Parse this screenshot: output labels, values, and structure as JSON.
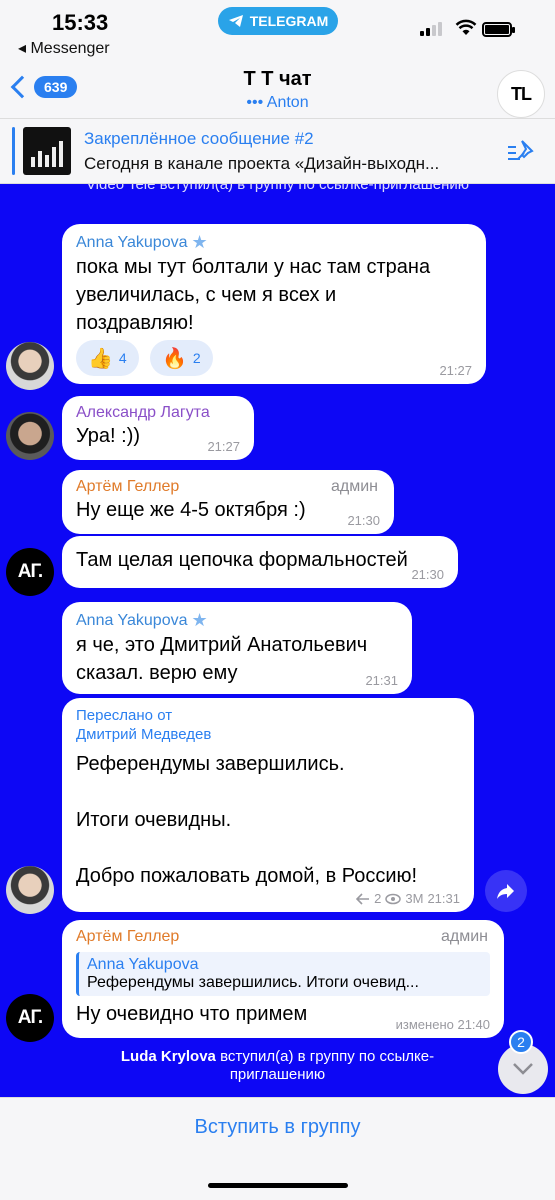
{
  "status": {
    "time": "15:33",
    "back_app": "◂ Messenger",
    "pill_label": "TELEGRAM"
  },
  "header": {
    "unread_count": "639",
    "title": "Т Т чат",
    "subtitle": "••• Anton",
    "avatar_text": "TL"
  },
  "pinned": {
    "title": "Закреплённое сообщение #2",
    "text": "Сегодня в канале проекта «Дизайн-выходн..."
  },
  "chat": {
    "top_service": "Video Tele вступил(а) в группу по ссылке-приглашению",
    "top_service_tail": "приглашению",
    "messages": [
      {
        "sender": "Anna Yakupova",
        "sender_color": "#3a87d8",
        "verified": "★",
        "lines": [
          "пока мы тут болтали у нас там страна",
          "увеличилась, с чем я всех и",
          "поздравляю!"
        ],
        "reactions": [
          {
            "emoji": "👍",
            "count": "4"
          },
          {
            "emoji": "🔥",
            "count": "2"
          }
        ],
        "time": "21:27"
      },
      {
        "sender": "Александр Лагута",
        "sender_color": "#8a4fc8",
        "text": "Ура! :))",
        "time": "21:27"
      },
      {
        "sender": "Артём Геллер",
        "sender_color": "#e07b2a",
        "role": "админ",
        "text": "Ну еще же 4-5 октября :)",
        "time": "21:30"
      },
      {
        "text": "Там целая цепочка формальностей",
        "time": "21:30"
      },
      {
        "sender": "Anna Yakupova",
        "sender_color": "#3a87d8",
        "verified": "★",
        "lines": [
          "я че, это Дмитрий Анатольевич",
          "сказал. верю ему"
        ],
        "time": "21:31"
      },
      {
        "forward_label": "Переслано от",
        "forward_from": "Дмитрий Медведев",
        "lines": [
          "Референдумы завершились.",
          "",
          "Итоги очевидны.",
          "",
          "Добро пожаловать домой, в Россию!"
        ],
        "replies": "2",
        "views": "3M",
        "time": "21:31"
      },
      {
        "sender": "Артём Геллер",
        "sender_color": "#e07b2a",
        "role": "админ",
        "reply_name": "Anna Yakupova",
        "reply_text": "Референдумы завершились.   Итоги очевид...",
        "text": "Ну очевидно что примем",
        "time": "изменено 21:40"
      }
    ],
    "bottom_service_name": "Luda Krylova",
    "bottom_service_text": " вступил(а) в группу по ссылке-",
    "bottom_service_tail": "приглашению",
    "scroll_badge": "2",
    "avatar_ag": "АГ."
  },
  "footer": {
    "join_label": "Вступить в группу"
  },
  "colors": {
    "chat_bg": "#0d07f5",
    "accent": "#2a7ff0"
  }
}
